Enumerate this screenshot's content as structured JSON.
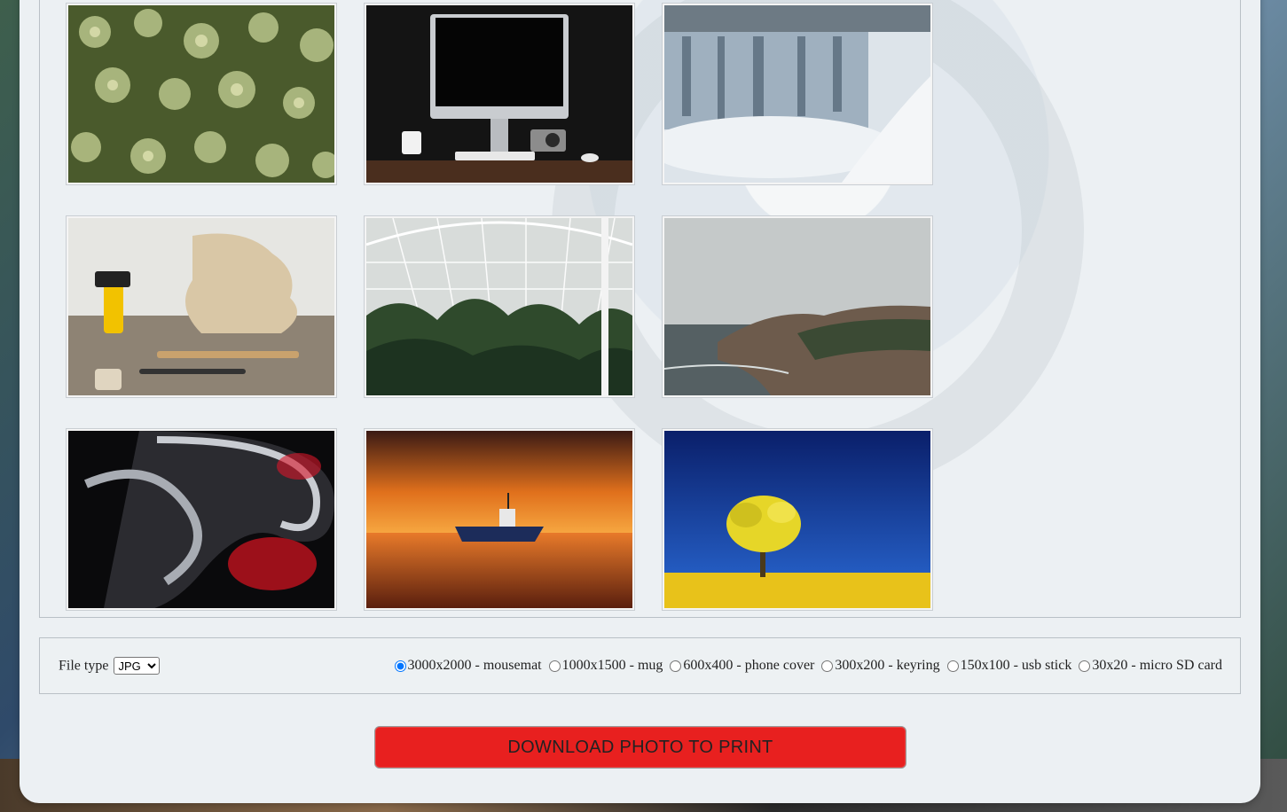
{
  "gallery": {
    "photos": [
      {
        "subject": "green succulent plants"
      },
      {
        "subject": "desktop computer with camera and mug"
      },
      {
        "subject": "frozen waterfall"
      },
      {
        "subject": "woodworking tools and guitar body"
      },
      {
        "subject": "greenhouse with ferns"
      },
      {
        "subject": "misty coastal cliffs"
      },
      {
        "subject": "abstract red and chrome shapes"
      },
      {
        "subject": "boat at orange sunset"
      },
      {
        "subject": "yellow tree under blue sky"
      }
    ]
  },
  "options": {
    "file_type_label": "File type",
    "file_type_value": "JPG",
    "sizes": [
      {
        "label": "3000x2000 - mousemat",
        "selected": true
      },
      {
        "label": "1000x1500 - mug",
        "selected": false
      },
      {
        "label": "600x400 - phone cover",
        "selected": false
      },
      {
        "label": "300x200 - keyring",
        "selected": false
      },
      {
        "label": "150x100 - usb stick",
        "selected": false
      },
      {
        "label": "30x20 - micro SD card",
        "selected": false
      }
    ]
  },
  "actions": {
    "download_label": "DOWNLOAD PHOTO TO PRINT"
  },
  "colors": {
    "download_button": "#e8201f",
    "radio_selected": "#1a73e8"
  }
}
